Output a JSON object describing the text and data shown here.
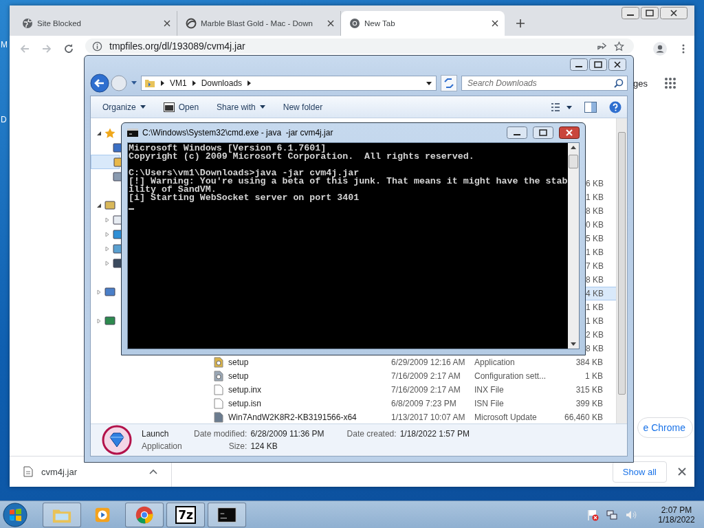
{
  "desktop": {
    "labels": [
      "M",
      "D"
    ]
  },
  "browser": {
    "tabs": [
      {
        "title": "Site Blocked",
        "kind": "globe",
        "selected": false
      },
      {
        "title": "Marble Blast Gold - Mac - Down",
        "kind": "site",
        "selected": false
      },
      {
        "title": "New Tab",
        "kind": "chrome",
        "selected": true
      }
    ],
    "nav": {
      "back_disabled": true,
      "forward_disabled": true
    },
    "address": "tmpfiles.org/dl/193089/cvm4j.jar",
    "page": {
      "link_fragment": "ges",
      "button_fragment": "e Chrome"
    },
    "download_bar": {
      "file": "cvm4j.jar",
      "show_all": "Show all"
    }
  },
  "explorer": {
    "breadcrumb": [
      "VM1",
      "Downloads"
    ],
    "search": {
      "placeholder": "Search Downloads"
    },
    "commands": [
      {
        "label": "Organize",
        "kind": "menu"
      },
      {
        "label": "Open",
        "kind": "icon"
      },
      {
        "label": "Share with",
        "kind": "menu"
      },
      {
        "label": "New folder",
        "kind": "plain"
      }
    ],
    "nav_pane": [
      {
        "kind": "favorites",
        "selected": false,
        "expanded": true,
        "children": [
          {
            "kind": "desktop",
            "selected": false
          },
          {
            "kind": "downloads",
            "selected": true
          },
          {
            "kind": "recent",
            "selected": false
          }
        ]
      },
      {
        "kind": "libraries",
        "selected": false,
        "expanded": true,
        "children": [
          {
            "kind": "documents",
            "selected": false,
            "expanded": false
          },
          {
            "kind": "music",
            "selected": false,
            "expanded": false
          },
          {
            "kind": "pictures",
            "selected": false,
            "expanded": false
          },
          {
            "kind": "videos",
            "selected": false,
            "expanded": false
          }
        ]
      },
      {
        "kind": "computer",
        "selected": false,
        "expanded": false
      },
      {
        "kind": "network",
        "selected": false,
        "expanded": false
      }
    ],
    "files": [
      {
        "size": "6 KB",
        "selected": false
      },
      {
        "size": "1 KB",
        "selected": false
      },
      {
        "size": "8 KB",
        "selected": false
      },
      {
        "size": "0 KB",
        "selected": false
      },
      {
        "size": "5 KB",
        "selected": false
      },
      {
        "size": "1 KB",
        "selected": false
      },
      {
        "size": "7 KB",
        "selected": false
      },
      {
        "size": "8 KB",
        "selected": false
      },
      {
        "size": "4 KB",
        "selected": true
      },
      {
        "size": "1 KB",
        "selected": false
      },
      {
        "size": "1 KB",
        "selected": false
      },
      {
        "size": "2 KB",
        "selected": false
      },
      {
        "size": "8 KB",
        "selected": false
      },
      {
        "name": "setup",
        "kind": "installer",
        "date": "6/29/2009 12:16 AM",
        "type": "Application",
        "size": "384 KB",
        "selected": false
      },
      {
        "name": "setup",
        "kind": "settings",
        "date": "7/16/2009 2:17 AM",
        "type": "Configuration sett...",
        "size": "1 KB",
        "selected": false
      },
      {
        "name": "setup.inx",
        "kind": "document",
        "date": "7/16/2009 2:17 AM",
        "type": "INX File",
        "size": "315 KB",
        "selected": false
      },
      {
        "name": "setup.isn",
        "kind": "document",
        "date": "6/8/2009 7:23 PM",
        "type": "ISN File",
        "size": "399 KB",
        "selected": false
      },
      {
        "name": "Win7AndW2K8R2-KB3191566-x64",
        "kind": "package",
        "date": "1/13/2017 10:07 AM",
        "type": "Microsoft Update",
        "size": "66,460 KB",
        "selected": false
      }
    ],
    "details": {
      "name": "Launch",
      "type": "Application",
      "fields": [
        {
          "label": "Date modified:",
          "value": "6/28/2009 11:36 PM"
        },
        {
          "label": "Date created:",
          "value": "1/18/2022 1:57 PM"
        },
        {
          "label": "Size:",
          "value": "124 KB"
        }
      ]
    }
  },
  "console": {
    "title": "C:\\Windows\\System32\\cmd.exe - java  -jar cvm4j.jar",
    "blocks": [
      [
        "Microsoft Windows [Version 6.1.7601]",
        "Copyright (c) 2009 Microsoft Corporation.  All rights reserved."
      ],
      [
        "C:\\Users\\vm1\\Downloads>java -jar cvm4j.jar",
        "[!] Warning: You're using a beta of this junk. That means it might have the stab",
        "ility of SandVM.",
        "[i] Starting WebSocket server on port 3401"
      ]
    ]
  },
  "taskbar": {
    "items": [
      {
        "kind": "folder",
        "running": true
      },
      {
        "kind": "player",
        "running": false
      },
      {
        "kind": "chrome",
        "running": true
      },
      {
        "kind": "archiver",
        "label": "7z",
        "running": true
      },
      {
        "kind": "console",
        "running": true
      }
    ],
    "clock": {
      "time": "2:07 PM",
      "date": "1/18/2022"
    }
  }
}
